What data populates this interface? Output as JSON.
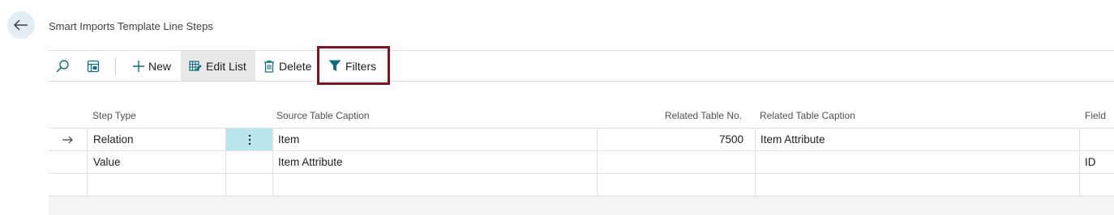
{
  "page": {
    "title": "Smart Imports Template Line Steps"
  },
  "toolbar": {
    "new_label": "New",
    "edit_list_label": "Edit List",
    "delete_label": "Delete",
    "filters_label": "Filters"
  },
  "grid": {
    "headers": {
      "step_type": "Step Type",
      "source_table_caption": "Source Table Caption",
      "related_table_no": "Related Table No.",
      "related_table_caption": "Related Table Caption",
      "field": "Field"
    },
    "rows": [
      {
        "step_type": "Relation",
        "source_table_caption": "Item",
        "related_table_no": "7500",
        "related_table_caption": "Item Attribute",
        "field": ""
      },
      {
        "step_type": "Value",
        "source_table_caption": "Item Attribute",
        "related_table_no": "",
        "related_table_caption": "",
        "field": "ID"
      },
      {
        "step_type": "",
        "source_table_caption": "",
        "related_table_no": "",
        "related_table_caption": "",
        "field": ""
      }
    ]
  },
  "colors": {
    "accent": "#0f6e7d",
    "highlight_border": "#7b1525",
    "selected_cell": "#b8e6ec"
  }
}
